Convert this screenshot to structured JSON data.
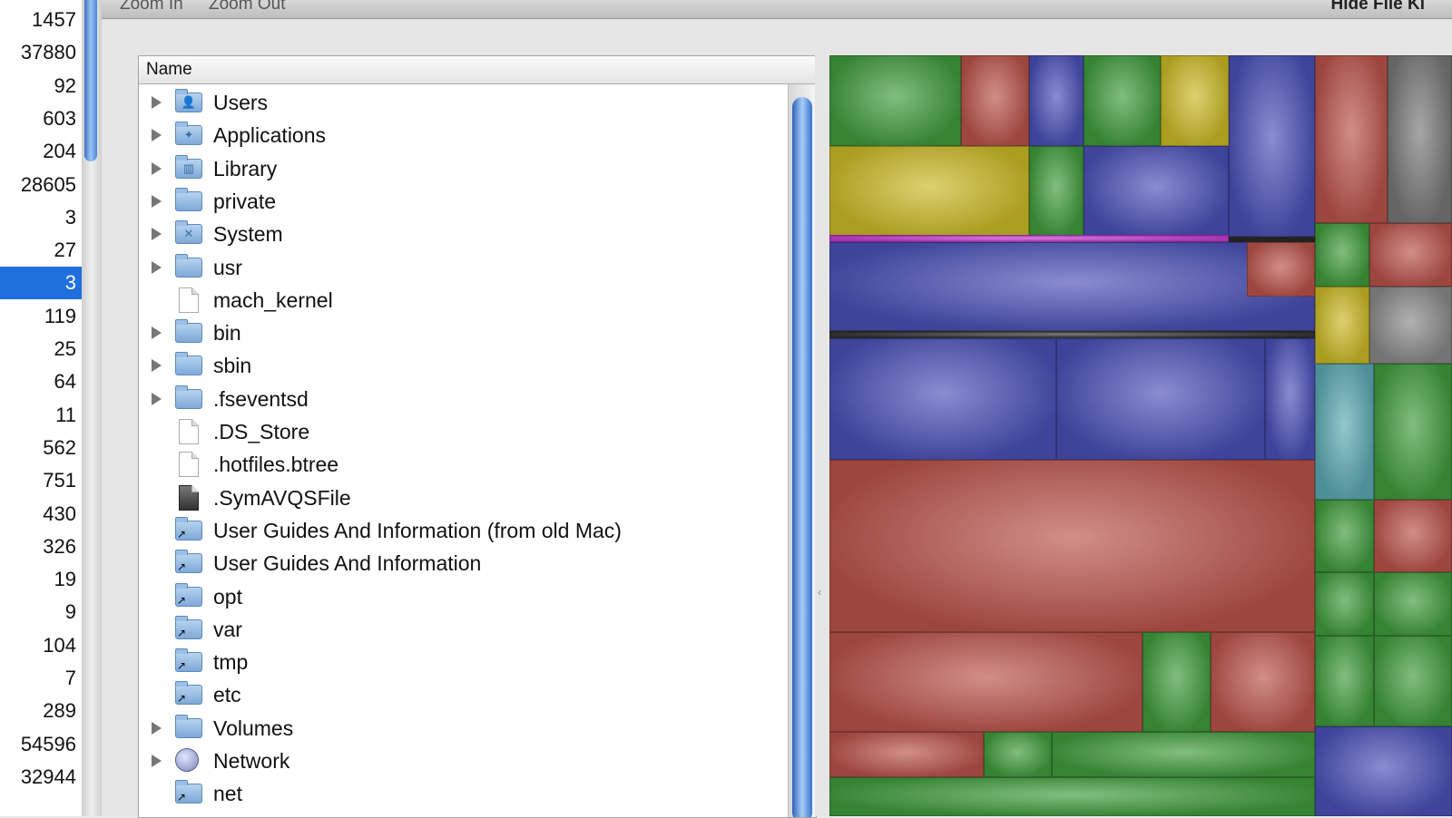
{
  "toolbar": {
    "zoom_in": "Zoom In",
    "zoom_out": "Zoom Out",
    "hide_file_kind": "Hide File Ki"
  },
  "counts": [
    "1457",
    "37880",
    "92",
    "603",
    "204",
    "28605",
    "3",
    "27",
    "3",
    "119",
    "25",
    "64",
    "11",
    "562",
    "751",
    "430",
    "326",
    "19",
    "9",
    "104",
    "7",
    "289",
    "54596",
    "32944"
  ],
  "selected_count_index": 8,
  "tree": {
    "column_name": "Name",
    "items": [
      {
        "label": "Users",
        "icon": "users-folder-icon",
        "expandable": true
      },
      {
        "label": "Applications",
        "icon": "applications-folder-icon",
        "expandable": true
      },
      {
        "label": "Library",
        "icon": "library-folder-icon",
        "expandable": true
      },
      {
        "label": "private",
        "icon": "folder-icon",
        "expandable": true
      },
      {
        "label": "System",
        "icon": "system-folder-icon",
        "expandable": true
      },
      {
        "label": "usr",
        "icon": "folder-icon",
        "expandable": true
      },
      {
        "label": "mach_kernel",
        "icon": "file-icon",
        "expandable": false
      },
      {
        "label": "bin",
        "icon": "folder-icon",
        "expandable": true
      },
      {
        "label": "sbin",
        "icon": "folder-icon",
        "expandable": true
      },
      {
        "label": ".fseventsd",
        "icon": "folder-icon",
        "expandable": true
      },
      {
        "label": ".DS_Store",
        "icon": "file-icon",
        "expandable": false
      },
      {
        "label": ".hotfiles.btree",
        "icon": "file-icon",
        "expandable": false
      },
      {
        "label": ".SymAVQSFile",
        "icon": "dark-file-icon",
        "expandable": false
      },
      {
        "label": "User Guides And Information (from old Mac)",
        "icon": "alias-folder-icon",
        "expandable": false
      },
      {
        "label": "User Guides And Information",
        "icon": "alias-folder-icon",
        "expandable": false
      },
      {
        "label": "opt",
        "icon": "alias-folder-icon",
        "expandable": false
      },
      {
        "label": "var",
        "icon": "alias-folder-icon",
        "expandable": false
      },
      {
        "label": "tmp",
        "icon": "alias-folder-icon",
        "expandable": false
      },
      {
        "label": "etc",
        "icon": "alias-folder-icon",
        "expandable": false
      },
      {
        "label": "Volumes",
        "icon": "folder-icon",
        "expandable": true
      },
      {
        "label": "Network",
        "icon": "network-globe-icon",
        "expandable": true
      },
      {
        "label": "net",
        "icon": "alias-folder-icon",
        "expandable": false
      }
    ]
  },
  "colors": {
    "selection": "#1f6fde",
    "treemap_green": "#3f9a3c",
    "treemap_blue": "#4a4fb5",
    "treemap_red": "#b8524a",
    "treemap_yellow": "#c9b825",
    "treemap_magenta": "#c43ad0",
    "treemap_teal": "#5aa8b0"
  }
}
